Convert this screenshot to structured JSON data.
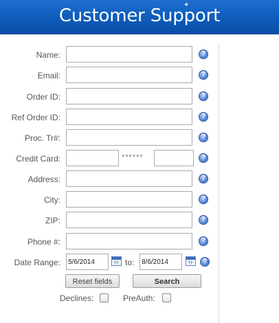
{
  "header": {
    "title": "Customer Support"
  },
  "form": {
    "fields": [
      {
        "label": "Name:",
        "value": ""
      },
      {
        "label": "Email:",
        "value": ""
      },
      {
        "label": "Order ID:",
        "value": ""
      },
      {
        "label": "Ref Order ID:",
        "value": ""
      },
      {
        "label": "Proc. Tr#:",
        "value": ""
      },
      {
        "label": "Credit Card:",
        "first_value": "",
        "mask": "******",
        "last_value": ""
      },
      {
        "label": "Address:",
        "value": ""
      },
      {
        "label": "City:",
        "value": ""
      },
      {
        "label": "ZIP:",
        "value": ""
      },
      {
        "label": "Phone #:",
        "value": ""
      }
    ],
    "date_range": {
      "label": "Date Range:",
      "from": "5/6/2014",
      "to_label": "to:",
      "to": "8/6/2014"
    },
    "buttons": {
      "reset": "Reset fields",
      "search": "Search"
    },
    "checkboxes": [
      {
        "label": "Declines:",
        "checked": false
      },
      {
        "label": "PreAuth:",
        "checked": false
      }
    ]
  }
}
